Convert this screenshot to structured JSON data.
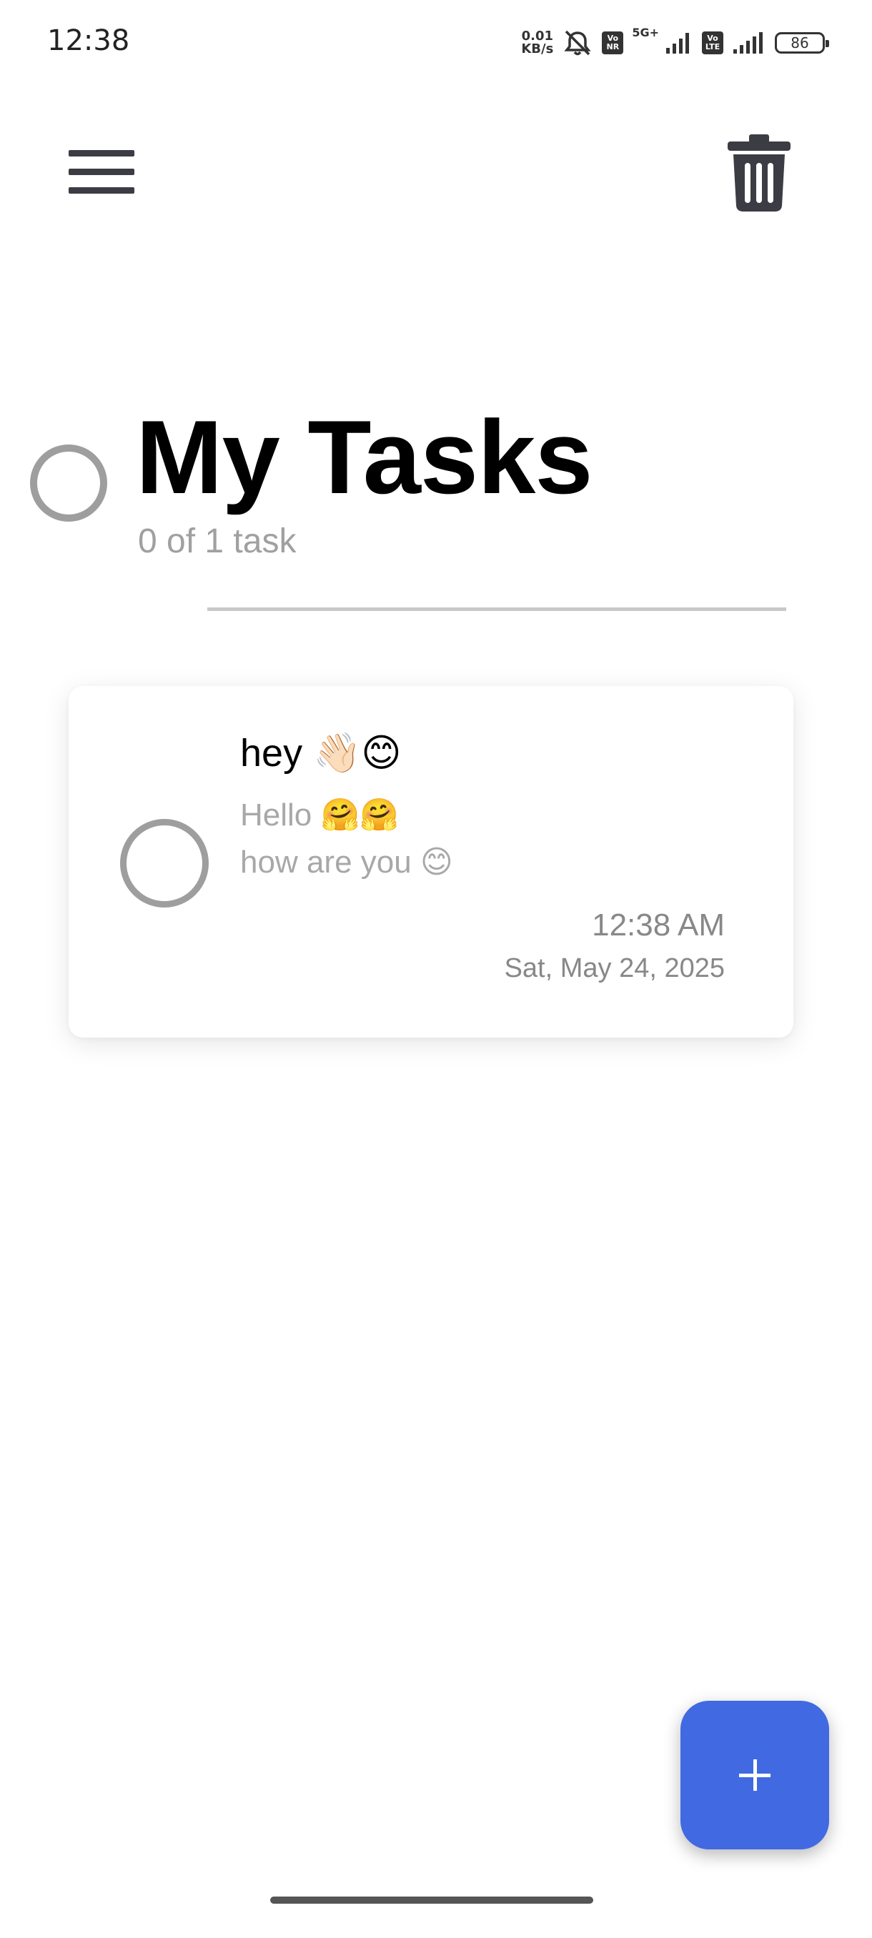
{
  "status_bar": {
    "time": "12:38",
    "net_speed_value": "0.01",
    "net_speed_unit": "KB/s",
    "sim1_badge_top": "Vo",
    "sim1_badge_bottom": "NR",
    "network_type": "5G+",
    "sim2_badge_top": "Vo",
    "sim2_badge_bottom": "LTE",
    "battery": "86",
    "icons": [
      "mute-bell-icon",
      "signal-icon",
      "battery-icon"
    ]
  },
  "toolbar": {
    "menu_icon": "hamburger-menu-icon",
    "delete_icon": "trash-icon"
  },
  "header": {
    "title": "My Tasks",
    "task_count": "0 of 1 task"
  },
  "tasks": [
    {
      "title": "hey 👋🏻😊",
      "note": "Hello 🤗🤗\nhow are you 😊",
      "time": "12:38 AM",
      "date": "Sat, May 24, 2025",
      "completed": false
    }
  ],
  "fab": {
    "label": "+",
    "icon": "plus-icon"
  },
  "colors": {
    "accent": "#4169e1",
    "checkbox_outline": "#9e9e9e",
    "secondary_text": "#a0a0a0",
    "icon_dark": "#3c3c44"
  }
}
